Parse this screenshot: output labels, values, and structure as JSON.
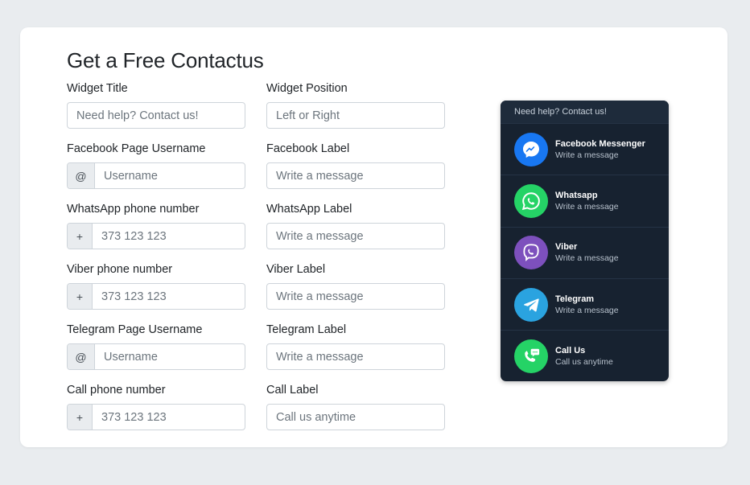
{
  "page": {
    "title": "Get a Free Contactus"
  },
  "form": {
    "rows": [
      {
        "left": {
          "label": "Widget Title",
          "placeholder": "Need help? Contact us!",
          "addon": ""
        },
        "right": {
          "label": "Widget Position",
          "placeholder": "Left or Right"
        }
      },
      {
        "left": {
          "label": "Facebook Page Username",
          "placeholder": "Username",
          "addon": "@"
        },
        "right": {
          "label": "Facebook Label",
          "placeholder": "Write a message"
        }
      },
      {
        "left": {
          "label": "WhatsApp phone number",
          "placeholder": "373 123 123",
          "addon": "+"
        },
        "right": {
          "label": "WhatsApp Label",
          "placeholder": "Write a message"
        }
      },
      {
        "left": {
          "label": "Viber phone number",
          "placeholder": "373 123 123",
          "addon": "+"
        },
        "right": {
          "label": "Viber Label",
          "placeholder": "Write a message"
        }
      },
      {
        "left": {
          "label": "Telegram Page Username",
          "placeholder": "Username",
          "addon": "@"
        },
        "right": {
          "label": "Telegram Label",
          "placeholder": "Write a message"
        }
      },
      {
        "left": {
          "label": "Call phone number",
          "placeholder": "373 123 123",
          "addon": "+"
        },
        "right": {
          "label": "Call Label",
          "placeholder": "Call us anytime"
        }
      }
    ]
  },
  "widget": {
    "header": "Need help? Contact us!",
    "items": [
      {
        "name": "Facebook Messenger",
        "sub": "Write a message",
        "icon": "messenger-icon",
        "color": "#1877f2"
      },
      {
        "name": "Whatsapp",
        "sub": "Write a message",
        "icon": "whatsapp-icon",
        "color": "#25d366"
      },
      {
        "name": "Viber",
        "sub": "Write a message",
        "icon": "viber-icon",
        "color": "#7d50bd"
      },
      {
        "name": "Telegram",
        "sub": "Write a message",
        "icon": "telegram-icon",
        "color": "#2aa3e0"
      },
      {
        "name": "Call Us",
        "sub": "Call us anytime",
        "icon": "phone-icon",
        "color": "#25d366"
      }
    ]
  },
  "colors": {
    "background": "#e9ecef",
    "widget_bg": "#172230",
    "widget_header_bg": "#1e2b3b"
  }
}
